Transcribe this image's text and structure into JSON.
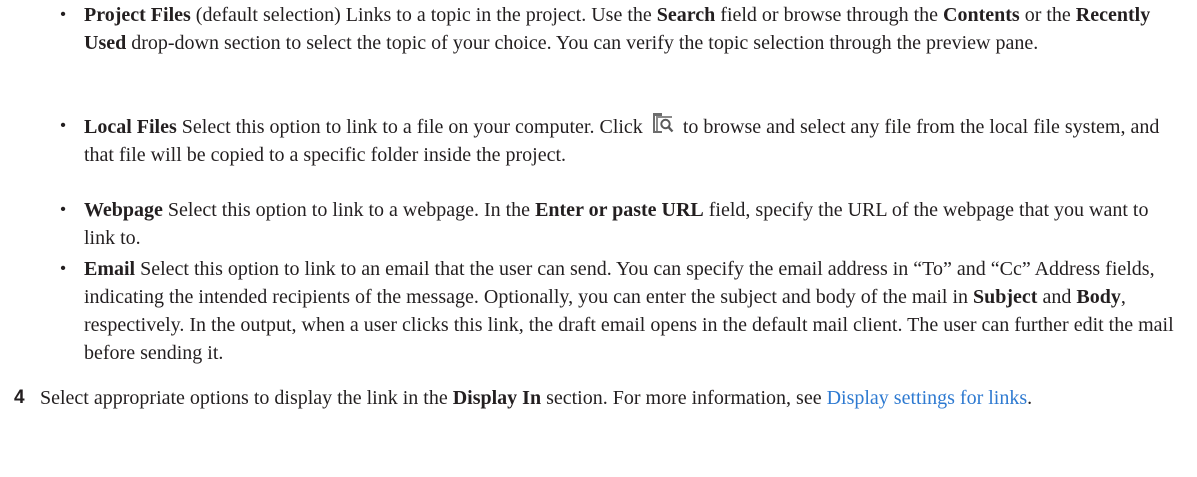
{
  "bullets": [
    {
      "term": "Project Files",
      "t1": " (default selection) Links to a topic in the project. Use the ",
      "b1": "Search",
      "t2": " field or browse through the ",
      "b2": "Contents",
      "t3": " or the ",
      "b3": "Recently Used",
      "t4": " drop-down section to select the topic of your choice. You can verify the topic selection through the preview pane."
    },
    {
      "term": "Local Files",
      "t1": " Select this option to link to a file on your computer. Click ",
      "icon": "browse-folder-icon",
      "t2": " to browse and select any file from the local file system, and that file will be copied to a specific folder inside the project."
    },
    {
      "term": "Webpage",
      "t1": " Select this option to link to a webpage. In the ",
      "b1": "Enter or paste URL",
      "t2": " field, specify the URL of the webpage that you want to link to."
    },
    {
      "term": "Email",
      "t1": " Select this option to link to an email that the user can send. You can specify the email address in “To” and “Cc” Address fields, indicating the intended recipients of the message.  Optionally, you can enter the subject and body of the mail in ",
      "b1": "Subject",
      "t2": " and ",
      "b2": "Body",
      "t3": ", respectively. In the output, when a user clicks this link, the draft email opens in the default mail client. The user can further edit the mail before sending it."
    }
  ],
  "step": {
    "number": "4",
    "t1": " Select appropriate options to display the link in the ",
    "b1": "Display In",
    "t2": " section. For more information, see ",
    "link": "Display settings for links",
    "t3": "."
  },
  "colors": {
    "text": "#231f20",
    "link": "#2e7ad1"
  }
}
